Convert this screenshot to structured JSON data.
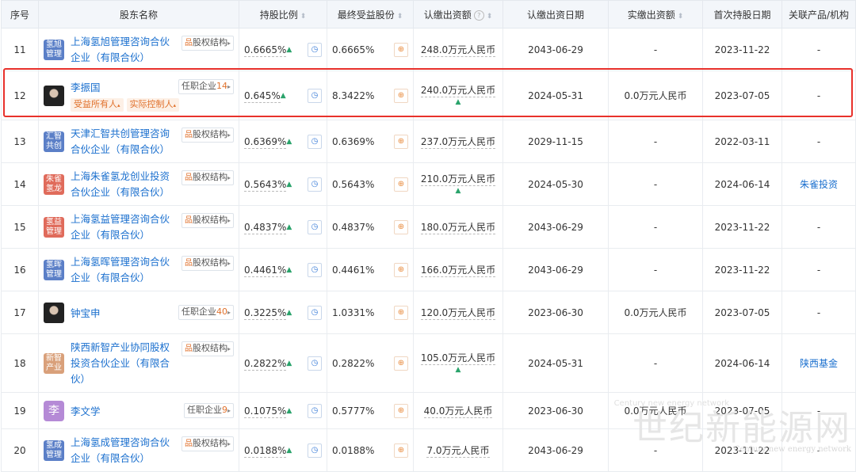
{
  "header": {
    "no": "序号",
    "name": "股东名称",
    "pct": "持股比例",
    "final": "最终受益股份",
    "subscribed": "认缴出资额",
    "sub_date": "认缴出资日期",
    "paid": "实缴出资额",
    "first_date": "首次持股日期",
    "related": "关联产品/机构"
  },
  "labels": {
    "equity_structure": "股权结构",
    "post_company": "任职企业",
    "beneficial_owner": "受益所有人",
    "actual_controller": "实际控制人"
  },
  "colors": {
    "highlight": "#e8312b",
    "link": "#1a6fce",
    "up_arrow": "#2aa36b",
    "tag": "#e0712c"
  },
  "rows": [
    {
      "no": "11",
      "type": "company",
      "logo": "氢旭管理",
      "logo_color": "#5b7fc7",
      "name": "上海氢旭管理咨询合伙企业（有限合伙）",
      "pct": "0.6665%",
      "pct_up": true,
      "final": "0.6665%",
      "sub": "248.0万元人民币",
      "sub_up": false,
      "sub_date": "2043-06-29",
      "paid": "-",
      "first": "2023-11-22",
      "rel": "-",
      "rel_link": false
    },
    {
      "no": "12",
      "type": "person",
      "logo": "",
      "name": "李振国",
      "post_count": "14",
      "roles": [
        "受益所有人",
        "实际控制人"
      ],
      "pct": "0.645%",
      "pct_up": true,
      "final": "8.3422%",
      "sub": "240.0万元人民币",
      "sub_up": true,
      "sub_date": "2024-05-31",
      "paid": "0.0万元人民币",
      "first": "2023-07-05",
      "rel": "-",
      "rel_link": false
    },
    {
      "no": "13",
      "type": "company",
      "logo": "汇智共创",
      "logo_color": "#5b7fc7",
      "name": "天津汇智共创管理咨询合伙企业（有限合伙）",
      "pct": "0.6369%",
      "pct_up": true,
      "final": "0.6369%",
      "sub": "237.0万元人民币",
      "sub_up": false,
      "sub_date": "2029-11-15",
      "paid": "-",
      "first": "2022-03-11",
      "rel": "-",
      "rel_link": false
    },
    {
      "no": "14",
      "type": "company",
      "logo": "朱雀氢龙",
      "logo_color": "#e06b5b",
      "name": "上海朱雀氢龙创业投资合伙企业（有限合伙）",
      "pct": "0.5643%",
      "pct_up": true,
      "final": "0.5643%",
      "sub": "210.0万元人民币",
      "sub_up": true,
      "sub_date": "2024-05-30",
      "paid": "-",
      "first": "2024-06-14",
      "rel": "朱雀投资",
      "rel_link": true
    },
    {
      "no": "15",
      "type": "company",
      "logo": "氢益管理",
      "logo_color": "#e06b5b",
      "name": "上海氢益管理咨询合伙企业（有限合伙）",
      "pct": "0.4837%",
      "pct_up": true,
      "final": "0.4837%",
      "sub": "180.0万元人民币",
      "sub_up": false,
      "sub_date": "2043-06-29",
      "paid": "-",
      "first": "2023-11-22",
      "rel": "-",
      "rel_link": false
    },
    {
      "no": "16",
      "type": "company",
      "logo": "氢晖管理",
      "logo_color": "#5b7fc7",
      "name": "上海氢晖管理咨询合伙企业（有限合伙）",
      "pct": "0.4461%",
      "pct_up": true,
      "final": "0.4461%",
      "sub": "166.0万元人民币",
      "sub_up": false,
      "sub_date": "2043-06-29",
      "paid": "-",
      "first": "2023-11-22",
      "rel": "-",
      "rel_link": false
    },
    {
      "no": "17",
      "type": "person",
      "logo": "",
      "name": "钟宝申",
      "post_count": "40",
      "roles": [],
      "pct": "0.3225%",
      "pct_up": true,
      "final": "1.0331%",
      "sub": "120.0万元人民币",
      "sub_up": false,
      "sub_date": "2023-06-30",
      "paid": "0.0万元人民币",
      "first": "2023-07-05",
      "rel": "-",
      "rel_link": false
    },
    {
      "no": "18",
      "type": "company",
      "logo": "新智产业",
      "logo_color": "#d9a07a",
      "name": "陕西新智产业协同股权投资合伙企业（有限合伙）",
      "pct": "0.2822%",
      "pct_up": true,
      "final": "0.2822%",
      "sub": "105.0万元人民币",
      "sub_up": true,
      "sub_date": "2024-05-31",
      "paid": "-",
      "first": "2024-06-14",
      "rel": "陕西基金",
      "rel_link": true
    },
    {
      "no": "19",
      "type": "person_char",
      "logo": "李",
      "logo_color": "#b58ad6",
      "name": "李文学",
      "post_count": "9",
      "roles": [],
      "pct": "0.1075%",
      "pct_up": true,
      "final": "0.5777%",
      "sub": "40.0万元人民币",
      "sub_up": false,
      "sub_date": "2023-06-30",
      "paid": "0.0万元人民币",
      "first": "2023-07-05",
      "rel": "-",
      "rel_link": false
    },
    {
      "no": "20",
      "type": "company",
      "logo": "氢成管理",
      "logo_color": "#5b7fc7",
      "name": "上海氢成管理咨询合伙企业（有限合伙）",
      "pct": "0.0188%",
      "pct_up": true,
      "final": "0.0188%",
      "sub": "7.0万元人民币",
      "sub_up": false,
      "sub_date": "2043-06-29",
      "paid": "-",
      "first": "2023-11-22",
      "rel": "-",
      "rel_link": false
    }
  ],
  "watermark": {
    "cn": "世纪新能源网",
    "en": "Century new energy network"
  }
}
